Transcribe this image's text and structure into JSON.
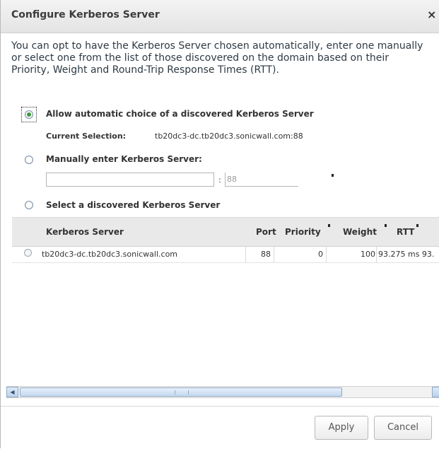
{
  "dialog": {
    "title": "Configure Kerberos Server",
    "close_label": "×",
    "intro": "You can opt to have the Kerberos Server chosen automatically, enter one manually or select one from the list of those discovered on the domain based on their Priority, Weight and Round-Trip Response Times (RTT)."
  },
  "options": {
    "auto_label": "Allow automatic choice of a discovered Kerberos Server",
    "current_selection_label": "Current Selection:",
    "current_selection_value": "tb20dc3-dc.tb20dc3.sonicwall.com:88",
    "manual_label": "Manually enter Kerberos Server:",
    "manual_server_value": "",
    "port_separator": ":",
    "manual_port_value": "88",
    "discovered_label": "Select a discovered Kerberos Server",
    "selected": "auto"
  },
  "table": {
    "columns": [
      "Kerberos Server",
      "Port",
      "Priority",
      "Weight",
      "RTT"
    ],
    "rows": [
      {
        "server": "tb20dc3-dc.tb20dc3.sonicwall.com",
        "port": "88",
        "priority": "0",
        "weight": "100",
        "rtt": "93.275 ms 93."
      }
    ]
  },
  "scrollbar": {
    "left_arrow": "◀"
  },
  "buttons": {
    "apply": "Apply",
    "cancel": "Cancel"
  },
  "colors": {
    "titlebar": "#e4e4e4",
    "radio_checked": "#3a9a3a",
    "header_bg": "#e9e9e9"
  }
}
